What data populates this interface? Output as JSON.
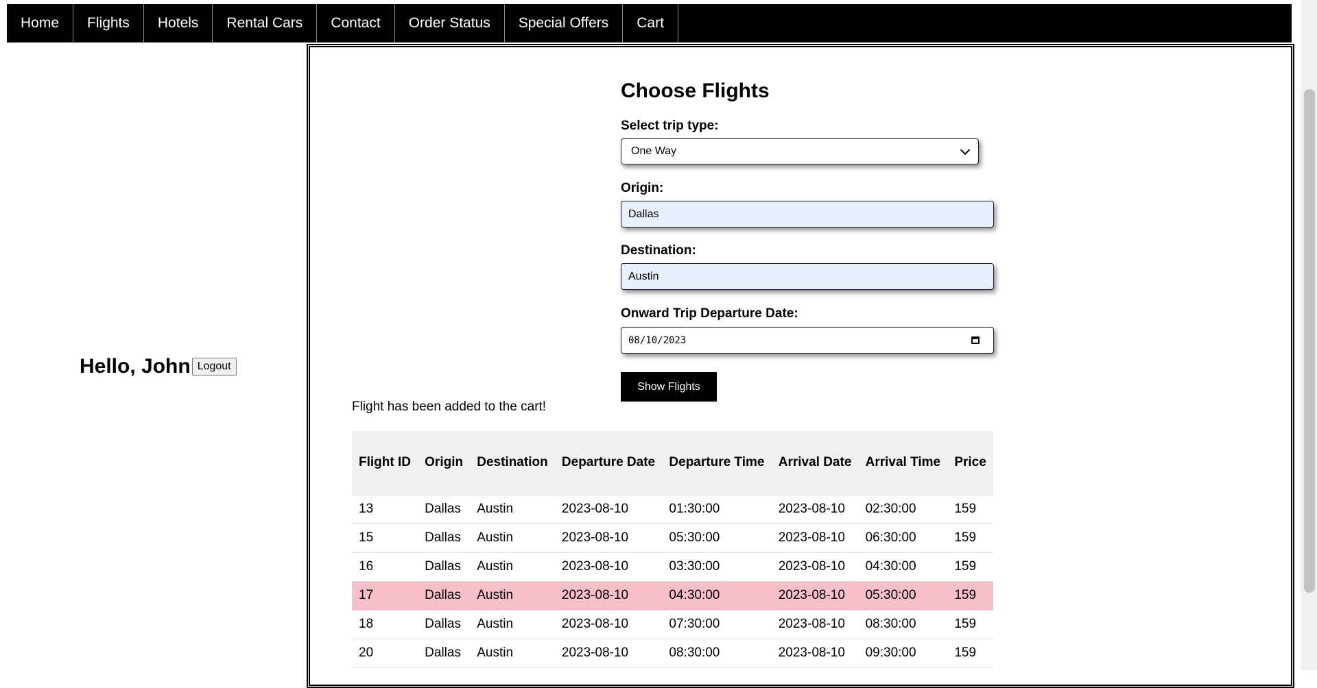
{
  "nav": {
    "items": [
      "Home",
      "Flights",
      "Hotels",
      "Rental Cars",
      "Contact",
      "Order Status",
      "Special Offers",
      "Cart"
    ]
  },
  "user": {
    "greeting": "Hello, John",
    "logout_label": "Logout"
  },
  "form": {
    "title": "Choose Flights",
    "trip_type_label": "Select trip type:",
    "trip_type_value": "One Way",
    "origin_label": "Origin:",
    "origin_value": "Dallas",
    "destination_label": "Destination:",
    "destination_value": "Austin",
    "date_label": "Onward Trip Departure Date:",
    "date_value": "08/10/2023",
    "submit_label": "Show Flights"
  },
  "message": "Flight has been added to the cart!",
  "table": {
    "headers": [
      "Flight ID",
      "Origin",
      "Destination",
      "Departure Date",
      "Departure Time",
      "Arrival Date",
      "Arrival Time",
      "Price"
    ],
    "rows": [
      [
        "13",
        "Dallas",
        "Austin",
        "2023-08-10",
        "01:30:00",
        "2023-08-10",
        "02:30:00",
        "159"
      ],
      [
        "15",
        "Dallas",
        "Austin",
        "2023-08-10",
        "05:30:00",
        "2023-08-10",
        "06:30:00",
        "159"
      ],
      [
        "16",
        "Dallas",
        "Austin",
        "2023-08-10",
        "03:30:00",
        "2023-08-10",
        "04:30:00",
        "159"
      ],
      [
        "17",
        "Dallas",
        "Austin",
        "2023-08-10",
        "04:30:00",
        "2023-08-10",
        "05:30:00",
        "159"
      ],
      [
        "18",
        "Dallas",
        "Austin",
        "2023-08-10",
        "07:30:00",
        "2023-08-10",
        "08:30:00",
        "159"
      ],
      [
        "20",
        "Dallas",
        "Austin",
        "2023-08-10",
        "08:30:00",
        "2023-08-10",
        "09:30:00",
        "159"
      ]
    ],
    "highlighted_row": 3,
    "highlight_color": "#f8bfcb"
  },
  "colors": {
    "nav_bg": "#000000",
    "input_autofill_bg": "#e8f0fe",
    "button_bg": "#000000"
  },
  "icons": [
    "chevron-down-icon",
    "calendar-icon"
  ]
}
